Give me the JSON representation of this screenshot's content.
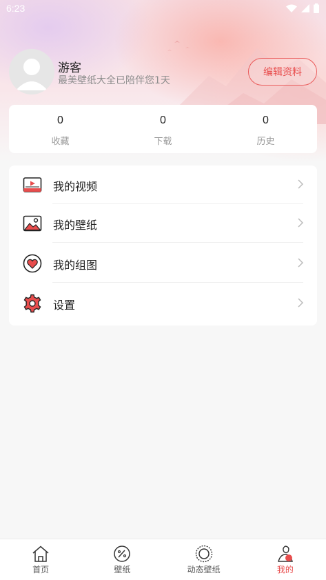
{
  "status": {
    "time": "6:23"
  },
  "profile": {
    "name": "游客",
    "subtitle": "最美壁纸大全已陪伴您1天",
    "edit_label": "编辑资料"
  },
  "stats": [
    {
      "value": "0",
      "label": "收藏"
    },
    {
      "value": "0",
      "label": "下载"
    },
    {
      "value": "0",
      "label": "历史"
    }
  ],
  "menu": [
    {
      "label": "我的视频",
      "icon": "video-icon"
    },
    {
      "label": "我的壁纸",
      "icon": "image-icon"
    },
    {
      "label": "我的组图",
      "icon": "heart-icon"
    },
    {
      "label": "设置",
      "icon": "gear-icon"
    }
  ],
  "tabs": [
    {
      "label": "首页",
      "icon": "home-icon",
      "active": false
    },
    {
      "label": "壁纸",
      "icon": "palette-icon",
      "active": false
    },
    {
      "label": "动态壁纸",
      "icon": "sun-icon",
      "active": false
    },
    {
      "label": "我的",
      "icon": "profile-icon",
      "active": true
    }
  ],
  "colors": {
    "accent": "#e84d4d",
    "background": "#f7f7f7"
  }
}
